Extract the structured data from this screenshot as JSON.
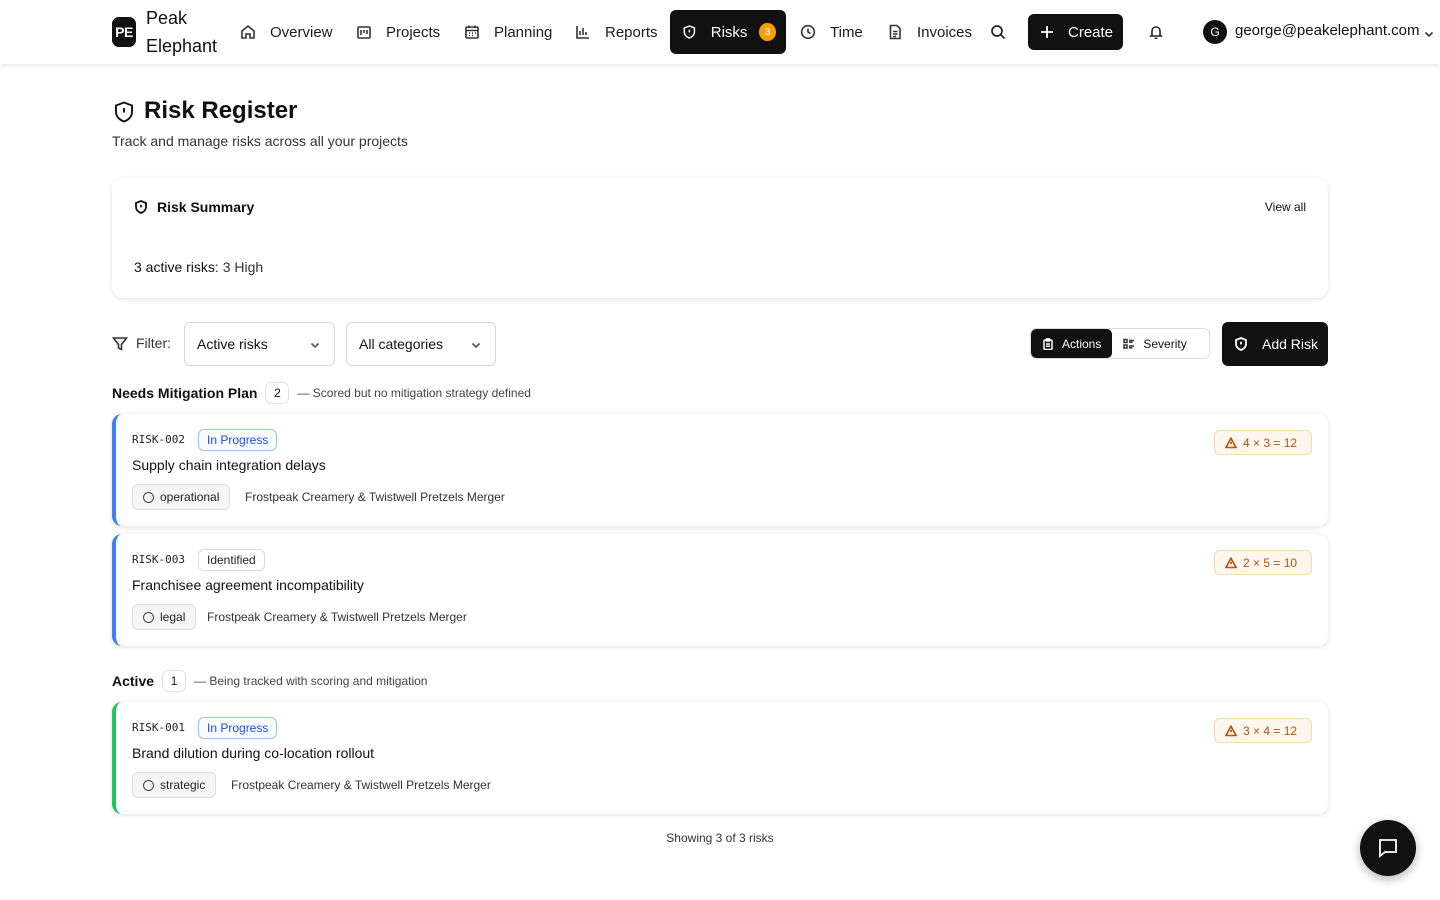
{
  "brand": {
    "initials": "PE",
    "name": "Peak Elephant"
  },
  "nav": {
    "overview": "Overview",
    "projects": "Projects",
    "planning": "Planning",
    "reports": "Reports",
    "risks": "Risks",
    "risks_badge": "3",
    "time": "Time",
    "invoices": "Invoices",
    "create": "Create",
    "user_initial": "G",
    "user_email": "george@peakelephant.com"
  },
  "page": {
    "title": "Risk Register",
    "subtitle": "Track and manage risks across all your projects"
  },
  "summary": {
    "title": "Risk Summary",
    "view_all": "View all",
    "count_label": "3 active risks",
    "breakdown": ": 3 High"
  },
  "filters": {
    "label": "Filter:",
    "status_value": "Active risks",
    "category_value": "All categories",
    "view_actions": "Actions",
    "view_severity": "Severity",
    "add_risk": "Add Risk"
  },
  "groups": [
    {
      "title": "Needs Mitigation Plan",
      "count": "2",
      "description": "— Scored but no mitigation strategy defined",
      "risks": [
        {
          "id": "RISK-002",
          "status": "In Progress",
          "title": "Supply chain integration delays",
          "category": "operational",
          "project": "Frostpeak Creamery & Twistwell Pretzels Merger",
          "score": "4 × 3 = 12"
        },
        {
          "id": "RISK-003",
          "status": "Identified",
          "title": "Franchisee agreement incompatibility",
          "category": "legal",
          "project": "Frostpeak Creamery & Twistwell Pretzels Merger",
          "score": "2 × 5 = 10"
        }
      ]
    },
    {
      "title": "Active",
      "count": "1",
      "description": "— Being tracked with scoring and mitigation",
      "risks": [
        {
          "id": "RISK-001",
          "status": "In Progress",
          "title": "Brand dilution during co-location rollout",
          "category": "strategic",
          "project": "Frostpeak Creamery & Twistwell Pretzels Merger",
          "score": "3 × 4 = 12"
        }
      ]
    }
  ],
  "footer": {
    "showing": "Showing 3 of 3 risks"
  },
  "colors": {
    "accent": "#111111",
    "badge": "#f59e0b",
    "in_progress": "#1d4ed8",
    "score": "#b45309",
    "group_blue": "#3b82f6",
    "group_green": "#22c55e"
  },
  "icons": [
    "home-icon",
    "projects-icon",
    "calendar-icon",
    "bar-chart-icon",
    "shield-icon",
    "clock-icon",
    "file-icon",
    "search-icon",
    "plus-icon",
    "bell-icon",
    "chevron-down-icon",
    "filter-icon",
    "clipboard-icon",
    "list-icon",
    "warning-icon",
    "circle-icon",
    "chat-icon"
  ]
}
